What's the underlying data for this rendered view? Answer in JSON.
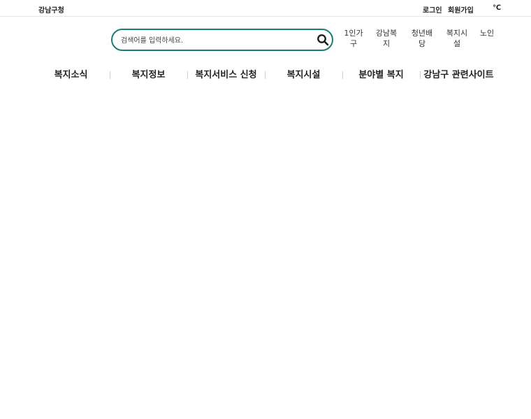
{
  "header": {
    "brand": "강남구청",
    "login_label": "로그인",
    "signup_label": "회원가입",
    "temperature_unit": "℃"
  },
  "search": {
    "placeholder": "검색어를 입력하세요.",
    "value": ""
  },
  "quick_links": [
    {
      "label": "1인가구"
    },
    {
      "label": "강남복지"
    },
    {
      "label": "청년배당"
    },
    {
      "label": "복지시설"
    },
    {
      "label": "노인"
    }
  ],
  "nav": {
    "items": [
      {
        "label": "복지소식"
      },
      {
        "label": "복지정보"
      },
      {
        "label": "복지서비스 신청"
      },
      {
        "label": "복지시설"
      },
      {
        "label": "분야별 복지"
      },
      {
        "label": "강남구 관련사이트"
      }
    ]
  },
  "colors": {
    "search_border": "#1a7d72",
    "search_icon": "#1e1e1e"
  },
  "icons": {
    "search": "search-icon"
  }
}
